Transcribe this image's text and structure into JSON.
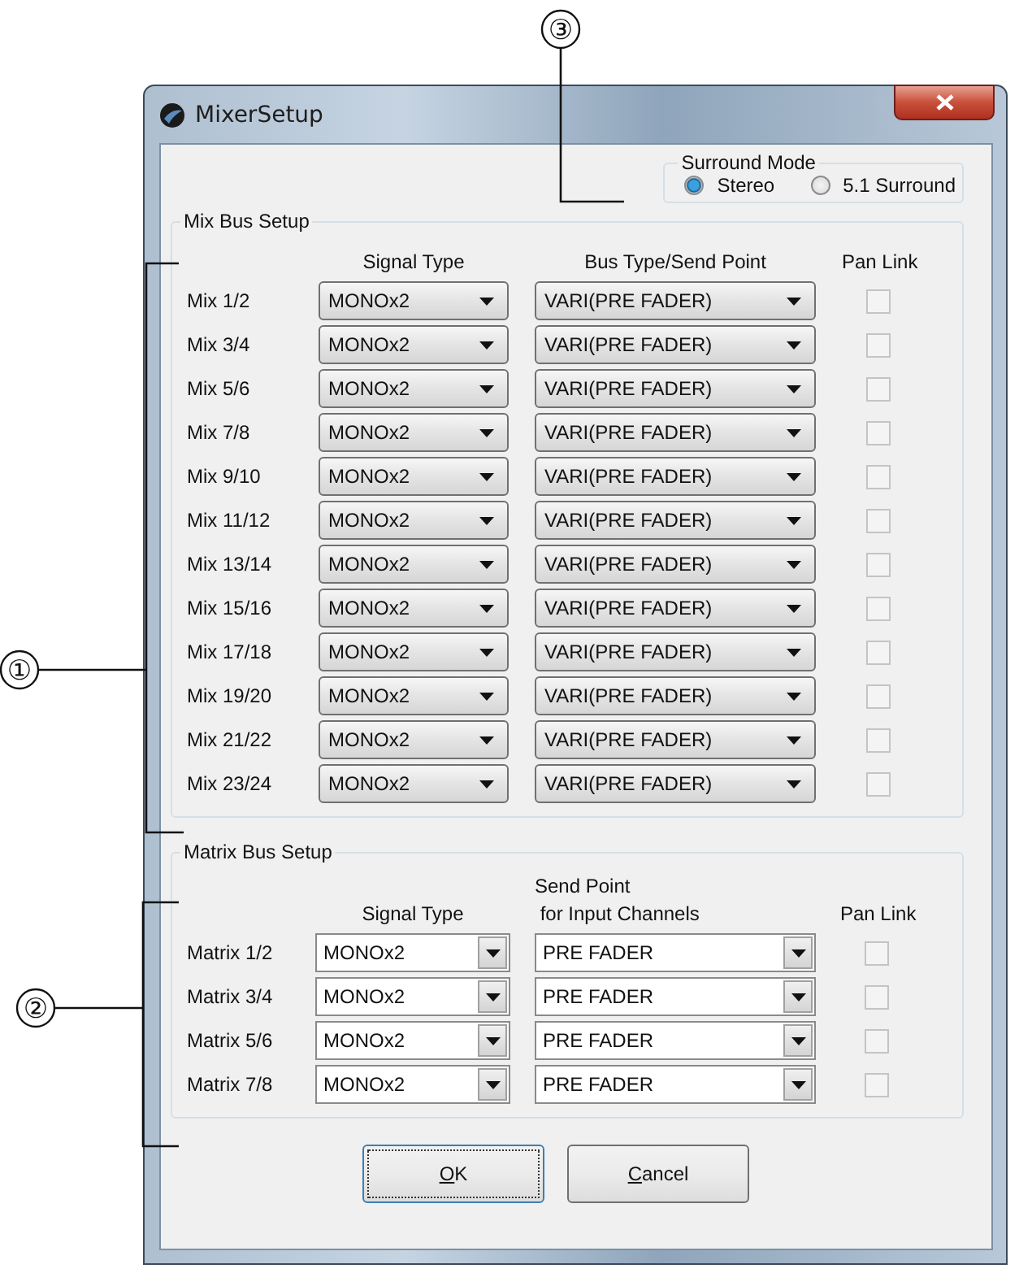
{
  "window": {
    "title": "MixerSetup"
  },
  "surround_mode": {
    "label": "Surround Mode",
    "options": [
      {
        "label": "Stereo",
        "selected": true
      },
      {
        "label": "5.1 Surround",
        "selected": false
      }
    ]
  },
  "mix_bus_setup": {
    "title": "Mix Bus Setup",
    "columns": [
      "Signal Type",
      "Bus Type/Send Point",
      "Pan Link"
    ],
    "rows": [
      {
        "name": "Mix 1/2",
        "signal_type": "MONOx2",
        "bus_type": "VARI(PRE FADER)",
        "pan_link": {
          "checked": false,
          "disabled": true
        }
      },
      {
        "name": "Mix 3/4",
        "signal_type": "MONOx2",
        "bus_type": "VARI(PRE FADER)",
        "pan_link": {
          "checked": false,
          "disabled": true
        }
      },
      {
        "name": "Mix 5/6",
        "signal_type": "MONOx2",
        "bus_type": "VARI(PRE FADER)",
        "pan_link": {
          "checked": false,
          "disabled": true
        }
      },
      {
        "name": "Mix 7/8",
        "signal_type": "MONOx2",
        "bus_type": "VARI(PRE FADER)",
        "pan_link": {
          "checked": false,
          "disabled": true
        }
      },
      {
        "name": "Mix 9/10",
        "signal_type": "MONOx2",
        "bus_type": "VARI(PRE FADER)",
        "pan_link": {
          "checked": false,
          "disabled": true
        }
      },
      {
        "name": "Mix 11/12",
        "signal_type": "MONOx2",
        "bus_type": "VARI(PRE FADER)",
        "pan_link": {
          "checked": false,
          "disabled": true
        }
      },
      {
        "name": "Mix 13/14",
        "signal_type": "MONOx2",
        "bus_type": "VARI(PRE FADER)",
        "pan_link": {
          "checked": false,
          "disabled": true
        }
      },
      {
        "name": "Mix 15/16",
        "signal_type": "MONOx2",
        "bus_type": "VARI(PRE FADER)",
        "pan_link": {
          "checked": false,
          "disabled": true
        }
      },
      {
        "name": "Mix 17/18",
        "signal_type": "MONOx2",
        "bus_type": "VARI(PRE FADER)",
        "pan_link": {
          "checked": false,
          "disabled": true
        }
      },
      {
        "name": "Mix 19/20",
        "signal_type": "MONOx2",
        "bus_type": "VARI(PRE FADER)",
        "pan_link": {
          "checked": false,
          "disabled": true
        }
      },
      {
        "name": "Mix 21/22",
        "signal_type": "MONOx2",
        "bus_type": "VARI(PRE FADER)",
        "pan_link": {
          "checked": false,
          "disabled": true
        }
      },
      {
        "name": "Mix 23/24",
        "signal_type": "MONOx2",
        "bus_type": "VARI(PRE FADER)",
        "pan_link": {
          "checked": false,
          "disabled": true
        }
      }
    ]
  },
  "matrix_bus_setup": {
    "title": "Matrix Bus Setup",
    "columns": [
      "Signal Type",
      "Send Point\n for Input Channels",
      "Pan Link"
    ],
    "rows": [
      {
        "name": "Matrix 1/2",
        "signal_type": "MONOx2",
        "send_point": "PRE FADER",
        "pan_link": {
          "checked": false,
          "disabled": true
        }
      },
      {
        "name": "Matrix 3/4",
        "signal_type": "MONOx2",
        "send_point": "PRE FADER",
        "pan_link": {
          "checked": false,
          "disabled": true
        }
      },
      {
        "name": "Matrix 5/6",
        "signal_type": "MONOx2",
        "send_point": "PRE FADER",
        "pan_link": {
          "checked": false,
          "disabled": true
        }
      },
      {
        "name": "Matrix 7/8",
        "signal_type": "MONOx2",
        "send_point": "PRE FADER",
        "pan_link": {
          "checked": false,
          "disabled": true
        }
      }
    ]
  },
  "buttons": [
    {
      "access_key": "O",
      "rest": "K",
      "default": true
    },
    {
      "access_key": "C",
      "rest": "ancel",
      "default": false
    }
  ],
  "callouts": [
    {
      "label": "③"
    },
    {
      "label": "①"
    },
    {
      "label": "②"
    }
  ]
}
